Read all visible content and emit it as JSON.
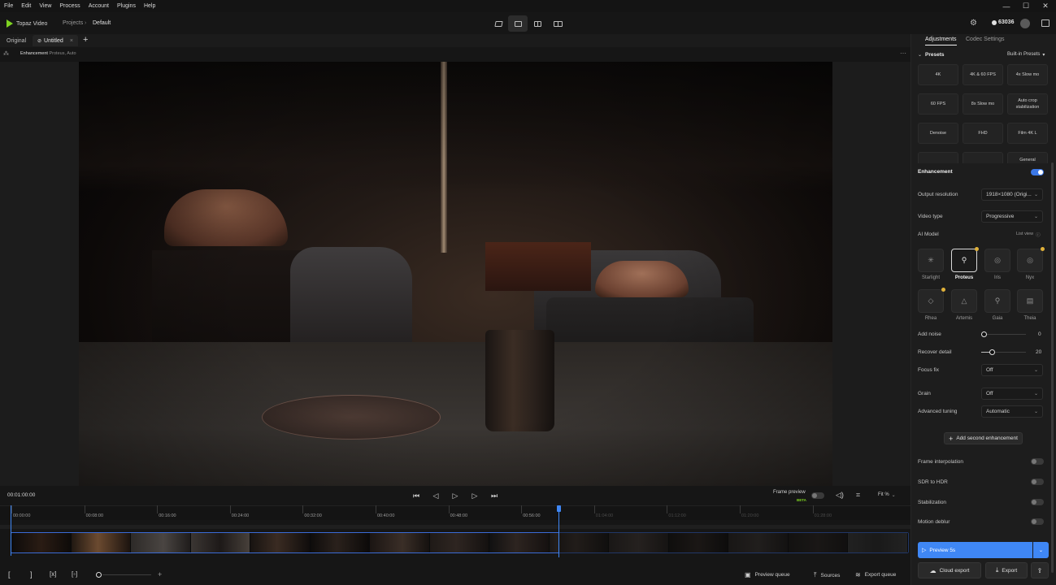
{
  "menu": [
    "File",
    "Edit",
    "View",
    "Process",
    "Account",
    "Plugins",
    "Help"
  ],
  "app": {
    "name": "Topaz Video"
  },
  "breadcrumb": {
    "projects": "Projects",
    "current": "Default"
  },
  "credits": "63036",
  "tabs": {
    "original": "Original",
    "untitled": "Untitled"
  },
  "info": {
    "label": "Enhancement",
    "detail": "Proteus, Auto"
  },
  "transport": {
    "time": "00:01:00:00",
    "frame_preview_label": "Frame preview",
    "beta_label": "BETA",
    "fit_label": "Fit %",
    "playhead_fraction": 0.61
  },
  "ruler": {
    "labels": [
      "00:00:00",
      "00:08:00",
      "00:16:00",
      "00:24:00",
      "00:32:00",
      "00:40:00",
      "00:48:00",
      "00:56:00",
      "01:04:00",
      "01:12:00",
      "01:20:00",
      "01:28:00"
    ]
  },
  "bottombar": {
    "preview_queue": "Preview queue",
    "sources": "Sources",
    "export_queue": "Export queue"
  },
  "panel": {
    "tabs": {
      "adjustments": "Adjustments",
      "codec": "Codec Settings"
    },
    "presets_title": "Presets",
    "presets_dropdown": "Built-in Presets",
    "presets": [
      "4K",
      "4K & 60 FPS",
      "4x Slow mo",
      "60 FPS",
      "8x Slow mo",
      "Auto crop stabilization",
      "Denoise",
      "FHD",
      "Film 4K L",
      "",
      "",
      "General"
    ],
    "enhancement": {
      "title": "Enhancement",
      "enabled": true
    },
    "output_resolution": {
      "label": "Output resolution",
      "value": "1918×1080 (Origi..."
    },
    "video_type": {
      "label": "Video type",
      "value": "Progressive"
    },
    "ai_model": {
      "label": "AI Model",
      "list_view": "List view",
      "models": [
        {
          "name": "Starlight",
          "icon": "sparkle-icon",
          "glyph": "✳"
        },
        {
          "name": "Proteus",
          "icon": "wrench-icon",
          "glyph": "⚲",
          "selected": true
        },
        {
          "name": "Iris",
          "icon": "eye-icon",
          "glyph": "◎"
        },
        {
          "name": "Nyx",
          "icon": "moon-icon",
          "glyph": "◎"
        },
        {
          "name": "Rhea",
          "icon": "diamond-icon",
          "glyph": "◇"
        },
        {
          "name": "Artemis",
          "icon": "triangle-icon",
          "glyph": "△"
        },
        {
          "name": "Gaia",
          "icon": "leaf-icon",
          "glyph": "⚲"
        },
        {
          "name": "Theia",
          "icon": "grid-icon",
          "glyph": "▤"
        }
      ]
    },
    "add_noise": {
      "label": "Add noise",
      "value": "0",
      "level": 0
    },
    "recover_detail": {
      "label": "Recover detail",
      "value": "20",
      "level": 0.2
    },
    "focus_fix": {
      "label": "Focus fix",
      "value": "Off"
    },
    "grain": {
      "label": "Grain",
      "value": "Off"
    },
    "advanced_tuning": {
      "label": "Advanced tuning",
      "value": "Automatic"
    },
    "add_second": "Add second enhancement",
    "toggles": {
      "frame_interpolation": "Frame interpolation",
      "sdr_to_hdr": "SDR to HDR",
      "stabilization": "Stabilization",
      "motion_deblur": "Motion deblur"
    },
    "preview_button": "Preview 5s",
    "cloud_export": "Cloud export",
    "export": "Export"
  },
  "colors": {
    "accent": "#3f87f5",
    "marker": "#e0b13a",
    "logo": "#7ed321"
  }
}
